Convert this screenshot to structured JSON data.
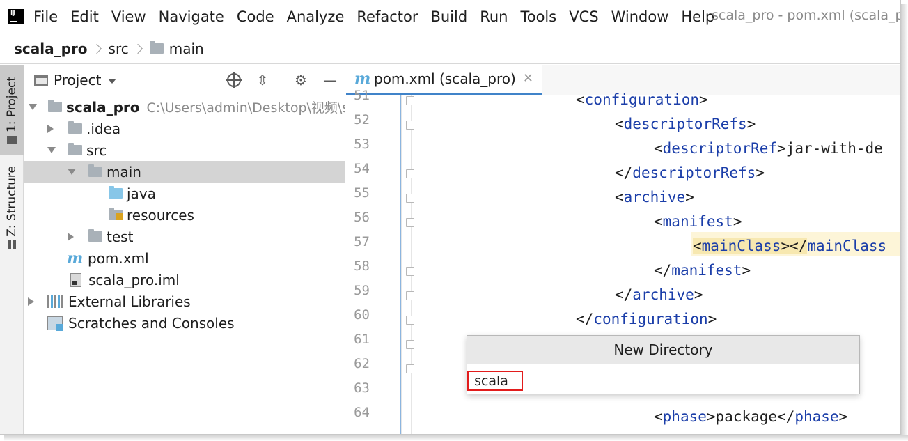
{
  "menu": {
    "items": [
      "File",
      "Edit",
      "View",
      "Navigate",
      "Code",
      "Analyze",
      "Refactor",
      "Build",
      "Run",
      "Tools",
      "VCS",
      "Window",
      "Help"
    ],
    "window_title": "scala_pro - pom.xml (scala_p"
  },
  "breadcrumb": {
    "project": "scala_pro",
    "src": "src",
    "main": "main"
  },
  "toolstrip": {
    "project_tab": "1: Project",
    "structure_tab": "Z: Structure"
  },
  "panel": {
    "title": "Project",
    "tree": [
      {
        "label": "scala_pro",
        "path": "C:\\Users\\admin\\Desktop\\视频\\s"
      },
      {
        "label": ".idea"
      },
      {
        "label": "src"
      },
      {
        "label": "main"
      },
      {
        "label": "java"
      },
      {
        "label": "resources"
      },
      {
        "label": "test"
      },
      {
        "label": "pom.xml"
      },
      {
        "label": "scala_pro.iml"
      },
      {
        "label": "External Libraries"
      },
      {
        "label": "Scratches and Consoles"
      }
    ]
  },
  "editor": {
    "tab_label": "pom.xml (scala_pro)",
    "line_numbers": [
      "51",
      "52",
      "53",
      "54",
      "55",
      "56",
      "57",
      "58",
      "59",
      "60",
      "61",
      "62",
      "63",
      "64"
    ],
    "code": [
      {
        "open": "<",
        "tag": "configuration",
        "close": ">"
      },
      {
        "open": "<",
        "tag": "descriptorRefs",
        "close": ">"
      },
      {
        "open": "<",
        "tag": "descriptorRef",
        "close": ">",
        "text": "jar-with-de"
      },
      {
        "open": "</",
        "tag": "descriptorRefs",
        "close": ">"
      },
      {
        "open": "<",
        "tag": "archive",
        "close": ">"
      },
      {
        "open": "<",
        "tag": "manifest",
        "close": ">"
      },
      {
        "open": "<",
        "tag": "mainClass",
        "close": "></",
        "tag2": "mainClass"
      },
      {
        "open": "</",
        "tag": "manifest",
        "close": ">"
      },
      {
        "open": "</",
        "tag": "archive",
        "close": ">"
      },
      {
        "open": "</",
        "tag": "configuration",
        "close": ">"
      },
      {
        "open": "<",
        "tag": "phase",
        "close": ">",
        "text": "package",
        "open2": "</",
        "tag2": "phase",
        "close2": ">"
      }
    ]
  },
  "popup": {
    "title": "New Directory",
    "value": "scala"
  }
}
